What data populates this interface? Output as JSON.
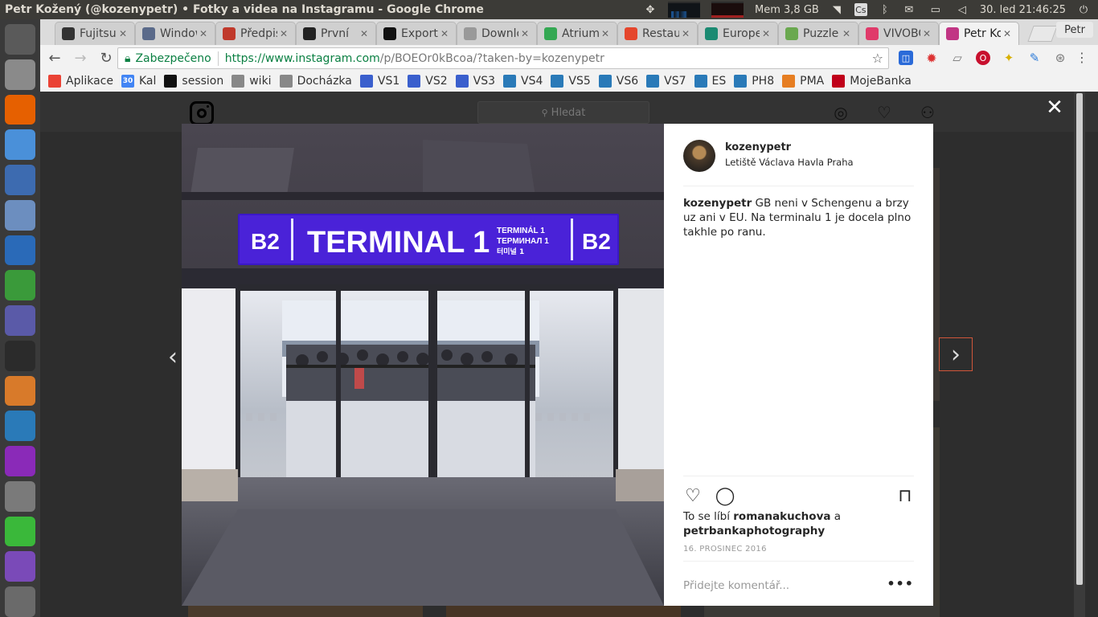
{
  "top_panel": {
    "window_title": "Petr Kožený (@kozenypetr) • Fotky a videa na Instagramu - Google Chrome",
    "memory": "Mem 3,8 GB",
    "keyboard_layout": "Cs",
    "datetime": "30. led 21:46:25",
    "user": "Petr"
  },
  "tabs": [
    {
      "label": "Fujitsu",
      "icon": "fujitsu-icon",
      "color": "#333333"
    },
    {
      "label": "Windows",
      "icon": "doc-icon",
      "color": "#5a6a8a"
    },
    {
      "label": "Předpis",
      "icon": "info-icon",
      "color": "#c0392b"
    },
    {
      "label": "První",
      "icon": "symfony-icon",
      "color": "#222222"
    },
    {
      "label": "Export",
      "icon": "f-icon",
      "color": "#111111"
    },
    {
      "label": "Download",
      "icon": "page-icon",
      "color": "#999999"
    },
    {
      "label": "Atrium",
      "icon": "maps-icon",
      "color": "#34a853"
    },
    {
      "label": "Restaurace",
      "icon": "e-icon",
      "color": "#e5462c"
    },
    {
      "label": "Europe",
      "icon": "ep-icon",
      "color": "#1b8a72"
    },
    {
      "label": "Puzzle",
      "icon": "leaf-icon",
      "color": "#6aa84f"
    },
    {
      "label": "VIVOBOOK",
      "icon": "exclaim-icon",
      "color": "#e03a6a"
    },
    {
      "label": "Petr Kožený",
      "icon": "instagram-icon",
      "color": "#c13584",
      "active": true
    }
  ],
  "toolbar": {
    "secure_label": "Zabezpečeno",
    "url_main": "https://www.instagram.com",
    "url_rest": "/p/BOEOr0kBcoa/?taken-by=kozenypetr"
  },
  "bookmarks": [
    {
      "label": "Aplikace",
      "icon": "apps-icon",
      "color": "#ea4335"
    },
    {
      "label": "Kal",
      "icon": "calendar-icon",
      "color": "#4285f4",
      "badge": "30"
    },
    {
      "label": "session",
      "icon": "session-icon",
      "color": "#111111"
    },
    {
      "label": "wiki",
      "icon": "page-icon",
      "color": "#888888"
    },
    {
      "label": "Docházka",
      "icon": "page-icon",
      "color": "#888888"
    },
    {
      "label": "VS1",
      "icon": "vs-icon",
      "color": "#3a5fcd"
    },
    {
      "label": "VS2",
      "icon": "vs-icon",
      "color": "#3a5fcd"
    },
    {
      "label": "VS3",
      "icon": "vs-icon",
      "color": "#3a5fcd"
    },
    {
      "label": "VS4",
      "icon": "puzzle-icon",
      "color": "#2a7ab8"
    },
    {
      "label": "VS5",
      "icon": "puzzle-icon",
      "color": "#2a7ab8"
    },
    {
      "label": "VS6",
      "icon": "puzzle-icon",
      "color": "#2a7ab8"
    },
    {
      "label": "VS7",
      "icon": "puzzle-icon",
      "color": "#2a7ab8"
    },
    {
      "label": "ES",
      "icon": "puzzle-icon",
      "color": "#2a7ab8"
    },
    {
      "label": "PH8",
      "icon": "puzzle-icon",
      "color": "#2a7ab8"
    },
    {
      "label": "PMA",
      "icon": "pma-icon",
      "color": "#e67e22"
    },
    {
      "label": "MojeBanka",
      "icon": "bank-icon",
      "color": "#c0001a"
    }
  ],
  "instagram": {
    "search_placeholder": "Hledat",
    "post": {
      "author": "kozenypetr",
      "location": "Letiště Václava Havla Praha",
      "caption": "GB neni v Schengenu a brzy uz ani v EU. Na terminalu 1 je docela plno takhle po ranu.",
      "likes_prefix": "To se líbí",
      "liker_1": "romanakuchova",
      "likes_conjunction": "a",
      "liker_2": "petrbankaphotography",
      "date": "16. PROSINEC 2016",
      "comment_placeholder": "Přidejte komentář..."
    },
    "photo_sign": {
      "left_badge": "B2",
      "main": "TERMINAL 1",
      "sub_1": "TERMINÁL 1",
      "sub_2": "ТЕРМИНАЛ 1",
      "sub_3": "터미널 1",
      "right_badge": "B2"
    }
  },
  "launcher": [
    {
      "icon": "ubuntu-dash-icon",
      "color": "#5a5a5a"
    },
    {
      "icon": "files-icon",
      "color": "#8a8a8a"
    },
    {
      "icon": "firefox-icon",
      "color": "#e66000"
    },
    {
      "icon": "chrome-icon",
      "color": "#4a90d9"
    },
    {
      "icon": "thunderbird-icon",
      "color": "#3d6bb0"
    },
    {
      "icon": "virtualbox-icon",
      "color": "#6c8ebf"
    },
    {
      "icon": "writer-icon",
      "color": "#2a6ab8"
    },
    {
      "icon": "calc-icon",
      "color": "#3a9a3a"
    },
    {
      "icon": "impress-icon",
      "color": "#5a5aa8"
    },
    {
      "icon": "terminal-icon",
      "color": "#2b2b2b"
    },
    {
      "icon": "draw-icon",
      "color": "#d87a2a"
    },
    {
      "icon": "monitor-icon",
      "color": "#2a7ab8"
    },
    {
      "icon": "phpstorm-icon",
      "color": "#8a2ab8"
    },
    {
      "icon": "calculator-icon",
      "color": "#7a7a7a"
    },
    {
      "icon": "chat-icon",
      "color": "#3ab83a"
    },
    {
      "icon": "viber-icon",
      "color": "#7a4ab8"
    },
    {
      "icon": "scanner-icon",
      "color": "#6a6a6a"
    }
  ],
  "colors": {
    "secure_green": "#0b8043",
    "sign_purple": "#3a18c8",
    "next_border": "#d0563a"
  }
}
